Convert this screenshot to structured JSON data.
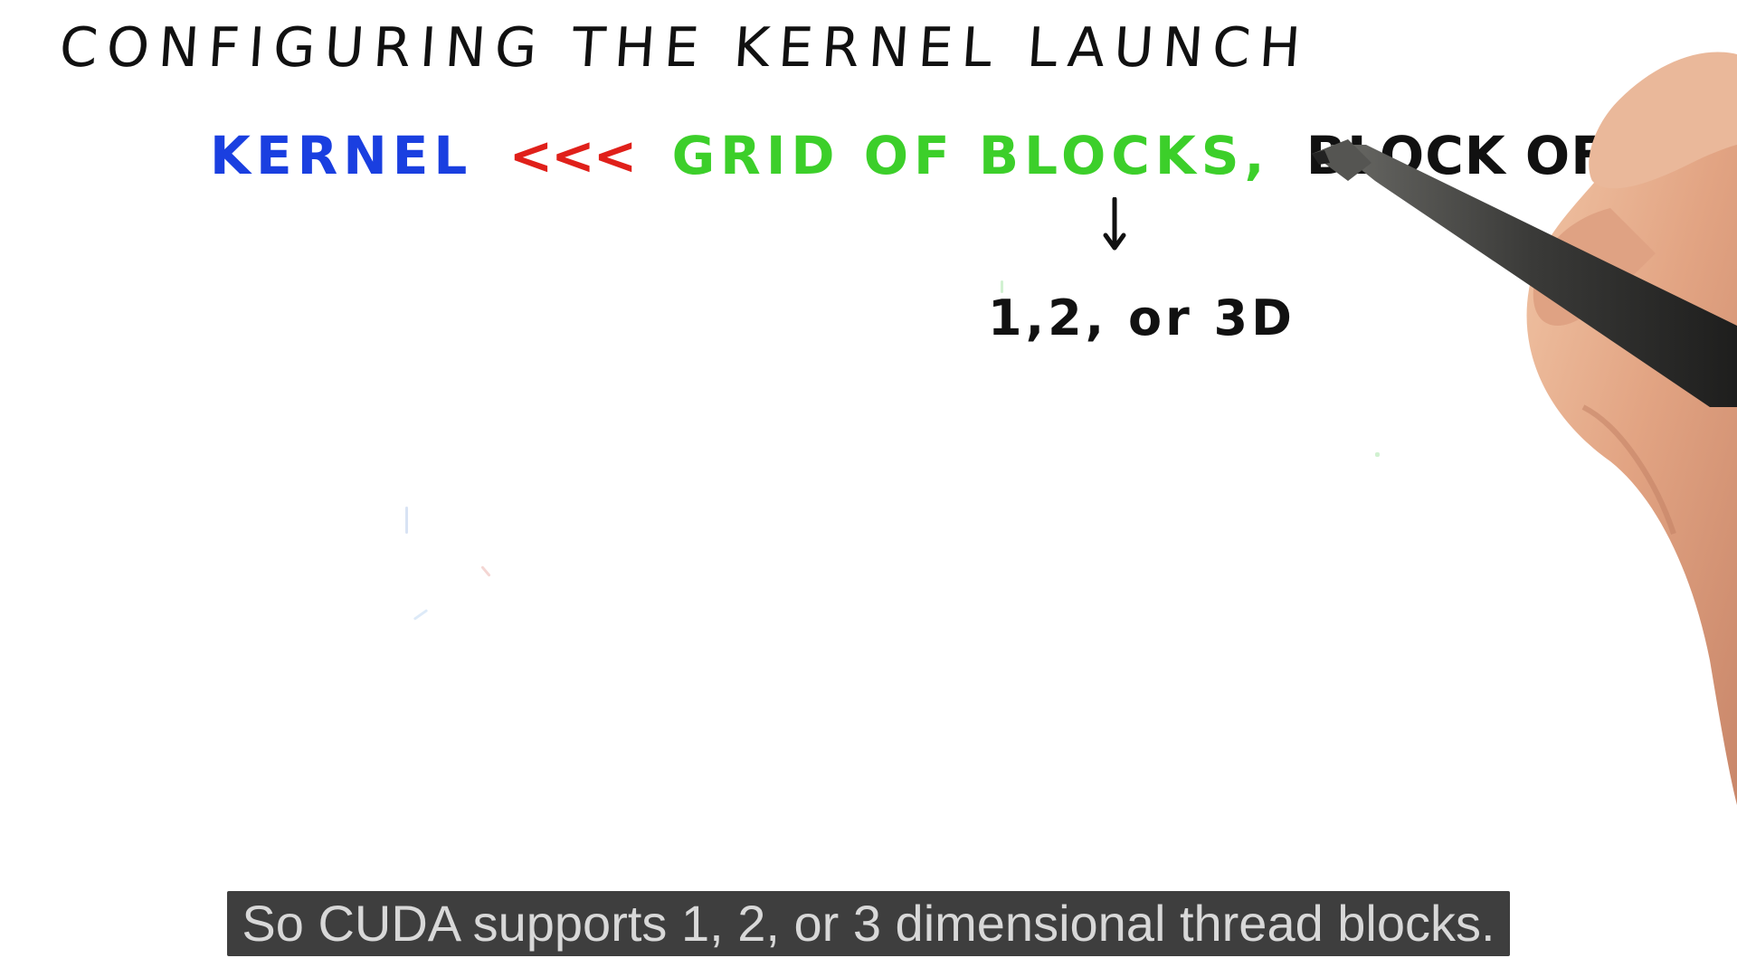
{
  "slide": {
    "title": "Configuring the Kernel Launch",
    "launch": {
      "kernel": "KERNEL",
      "open_chevrons": "<<<",
      "grid": "GRID OF BLOCKS,",
      "block": "BLOCK OF THREADS",
      "close_chevrons": ">>>",
      "args_open": "(",
      "args_dots": "...",
      "args_close": ")"
    },
    "dimensions_note": "1,2, or 3D",
    "arrow_icon": "down-arrow-icon",
    "hand_icon": "hand-holding-pen-icon"
  },
  "colors": {
    "ink_black": "#111111",
    "ink_blue": "#1a3fe0",
    "ink_red": "#e0201a",
    "ink_green": "#3ccf2a",
    "caption_bg": "#141414",
    "caption_text": "#d8d8d8"
  },
  "caption": {
    "text": "So CUDA supports 1, 2, or 3 dimensional thread blocks."
  }
}
